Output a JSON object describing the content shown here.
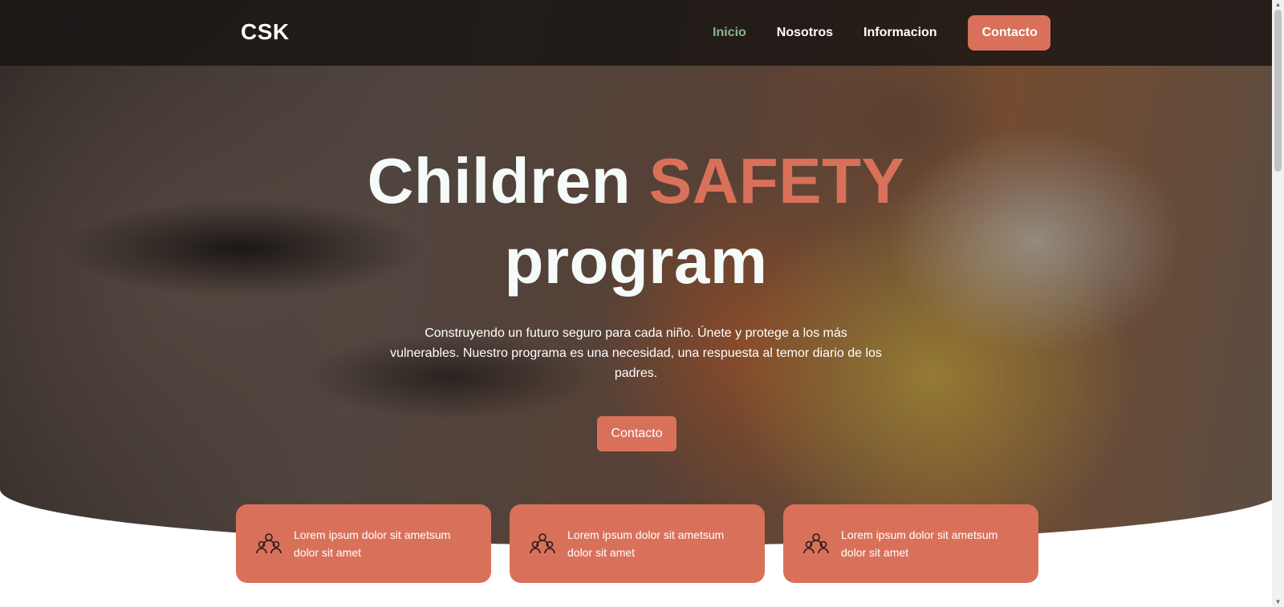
{
  "header": {
    "logo": "CSK",
    "nav": [
      {
        "label": "Inicio",
        "active": true
      },
      {
        "label": "Nosotros",
        "active": false
      },
      {
        "label": "Informacion",
        "active": false
      }
    ],
    "cta_label": "Contacto"
  },
  "hero": {
    "title_part1": "Children",
    "title_accent": "SAFETY",
    "title_part2": "program",
    "subtitle": "Construyendo un futuro seguro para cada niño. Únete y protege a los más vulnerables. Nuestro programa es una necesidad, una respuesta al temor diario de los padres.",
    "button_label": "Contacto"
  },
  "cards": [
    {
      "icon": "group-icon",
      "text": "Lorem ipsum dolor sit ametsum dolor sit amet"
    },
    {
      "icon": "group-icon",
      "text": "Lorem ipsum dolor sit ametsum dolor sit amet"
    },
    {
      "icon": "group-icon",
      "text": "Lorem ipsum dolor sit ametsum dolor sit amet"
    }
  ],
  "colors": {
    "accent": "#d9715a",
    "nav_active": "#8ab48a",
    "title_white": "#f4fbf8"
  }
}
